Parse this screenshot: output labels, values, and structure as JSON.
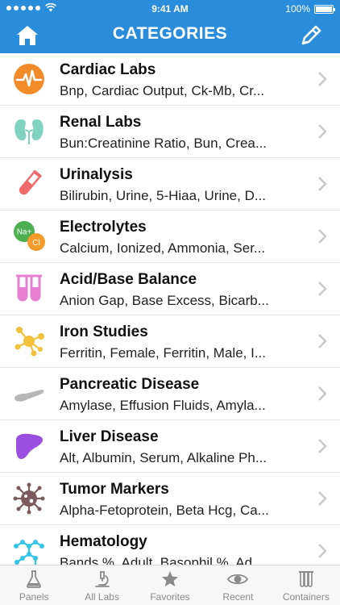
{
  "status": {
    "time": "9:41 AM",
    "battery": "100%"
  },
  "header": {
    "title": "CATEGORIES"
  },
  "categories": [
    {
      "title": "Cardiac Labs",
      "subtitle": "Bnp, Cardiac Output, Ck-Mb, Cr...",
      "icon": "heartbeat-icon"
    },
    {
      "title": "Renal Labs",
      "subtitle": "Bun:Creatinine Ratio, Bun, Crea...",
      "icon": "kidneys-icon"
    },
    {
      "title": "Urinalysis",
      "subtitle": "Bilirubin, Urine, 5-Hiaa, Urine, D...",
      "icon": "test-tube-icon"
    },
    {
      "title": "Electrolytes",
      "subtitle": "Calcium, Ionized, Ammonia, Ser...",
      "icon": "electrolytes-icon",
      "icon_labels": [
        "Na+",
        "Cl"
      ]
    },
    {
      "title": "Acid/Base Balance",
      "subtitle": "Anion Gap, Base Excess, Bicarb...",
      "icon": "test-tubes-icon"
    },
    {
      "title": "Iron Studies",
      "subtitle": "Ferritin, Female, Ferritin, Male, I...",
      "icon": "molecule-icon"
    },
    {
      "title": "Pancreatic Disease",
      "subtitle": "Amylase, Effusion Fluids, Amyla...",
      "icon": "pancreas-icon"
    },
    {
      "title": "Liver Disease",
      "subtitle": "Alt, Albumin, Serum, Alkaline Ph...",
      "icon": "liver-icon"
    },
    {
      "title": "Tumor Markers",
      "subtitle": "Alpha-Fetoprotein, Beta Hcg, Ca...",
      "icon": "virus-icon"
    },
    {
      "title": "Hematology",
      "subtitle": "Bands %, Adult, Basophil %, Ad...",
      "icon": "hexagon-network-icon"
    }
  ],
  "tabs": [
    {
      "label": "Panels",
      "icon": "flask-icon"
    },
    {
      "label": "All Labs",
      "icon": "microscope-icon"
    },
    {
      "label": "Favorites",
      "icon": "star-icon"
    },
    {
      "label": "Recent",
      "icon": "eye-icon"
    },
    {
      "label": "Containers",
      "icon": "test-tube-rack-icon"
    }
  ],
  "colors": {
    "accent": "#2a8ddc",
    "cardiac": "#f28c28",
    "renal": "#7fd3bf",
    "urinalysis": "#f06a6a",
    "electrolytes_na": "#4caf50",
    "electrolytes_cl": "#f59b2a",
    "acid_base": "#e77fd0",
    "iron": "#f4c13a",
    "pancreatic": "#b8b8b8",
    "liver": "#9b4fe0",
    "tumor": "#7a5a5a",
    "hematology": "#35c5e6",
    "tab_inactive": "#8a8a8a"
  }
}
